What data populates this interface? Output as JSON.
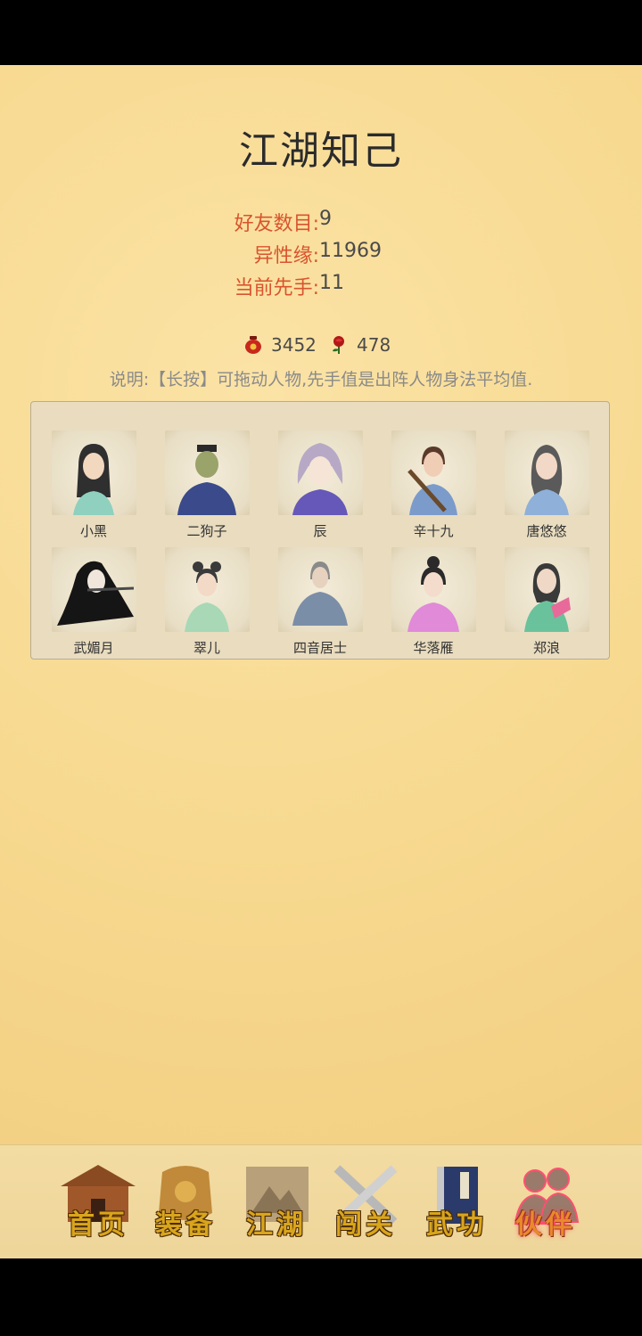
{
  "page": {
    "title": "江湖知己"
  },
  "stats": [
    {
      "label": "好友数目:",
      "value": "9"
    },
    {
      "label": "异性缘:",
      "value": "11969"
    },
    {
      "label": "当前先手:",
      "value": "11"
    }
  ],
  "currency": [
    {
      "icon": "wine-jar-icon",
      "value": "3452"
    },
    {
      "icon": "rose-icon",
      "value": "478"
    }
  ],
  "note": "说明:【长按】可拖动人物,先手值是出阵人物身法平均值.",
  "companions": [
    {
      "name": "小黑"
    },
    {
      "name": "二狗子"
    },
    {
      "name": "辰"
    },
    {
      "name": "辛十九"
    },
    {
      "name": "唐悠悠"
    },
    {
      "name": "武媚月"
    },
    {
      "name": "翠儿"
    },
    {
      "name": "四音居士"
    },
    {
      "name": "华落雁"
    },
    {
      "name": "郑浪"
    }
  ],
  "nav": [
    {
      "label": "首页",
      "icon": "house-icon"
    },
    {
      "label": "装备",
      "icon": "armor-icon"
    },
    {
      "label": "江湖",
      "icon": "scroll-map-icon"
    },
    {
      "label": "闯关",
      "icon": "crossed-swords-icon"
    },
    {
      "label": "武功",
      "icon": "book-icon"
    },
    {
      "label": "伙伴",
      "icon": "companions-icon",
      "active": true
    }
  ],
  "colors": {
    "label": "#d8542e",
    "accent": "#d9a51c",
    "background": "#f7d98f"
  }
}
